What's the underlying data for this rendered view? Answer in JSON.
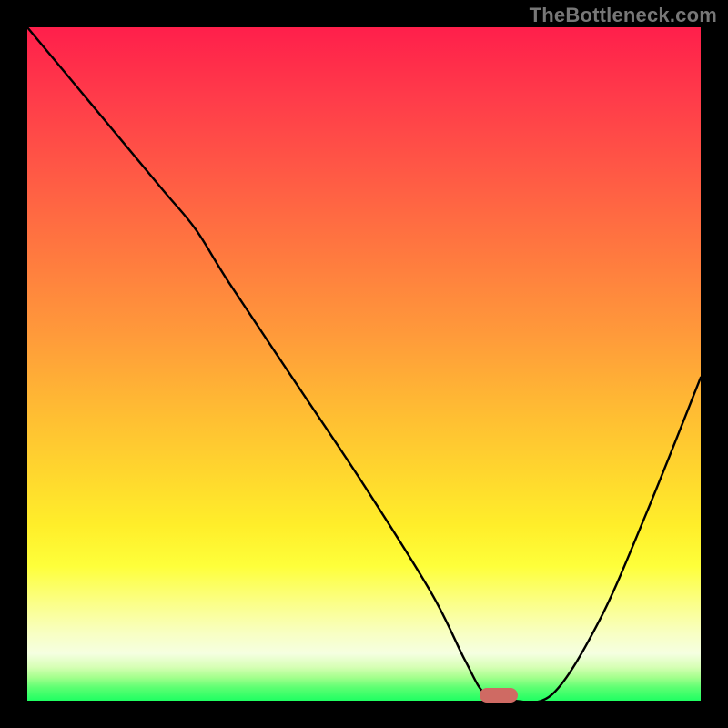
{
  "watermark": "TheBottleneck.com",
  "chart_data": {
    "type": "line",
    "title": "",
    "xlabel": "",
    "ylabel": "",
    "xlim": [
      0,
      100
    ],
    "ylim": [
      0,
      100
    ],
    "grid": false,
    "legend": false,
    "series": [
      {
        "name": "bottleneck-curve",
        "x": [
          0,
          10,
          20,
          25,
          30,
          40,
          50,
          60,
          65,
          68,
          72,
          78,
          85,
          92,
          100
        ],
        "y": [
          100,
          88,
          76,
          70,
          62,
          47,
          32,
          16,
          6,
          1,
          0,
          1,
          12,
          28,
          48
        ]
      }
    ],
    "annotations": [
      {
        "name": "optimal-marker",
        "x": 70,
        "y": 0.8
      }
    ]
  }
}
